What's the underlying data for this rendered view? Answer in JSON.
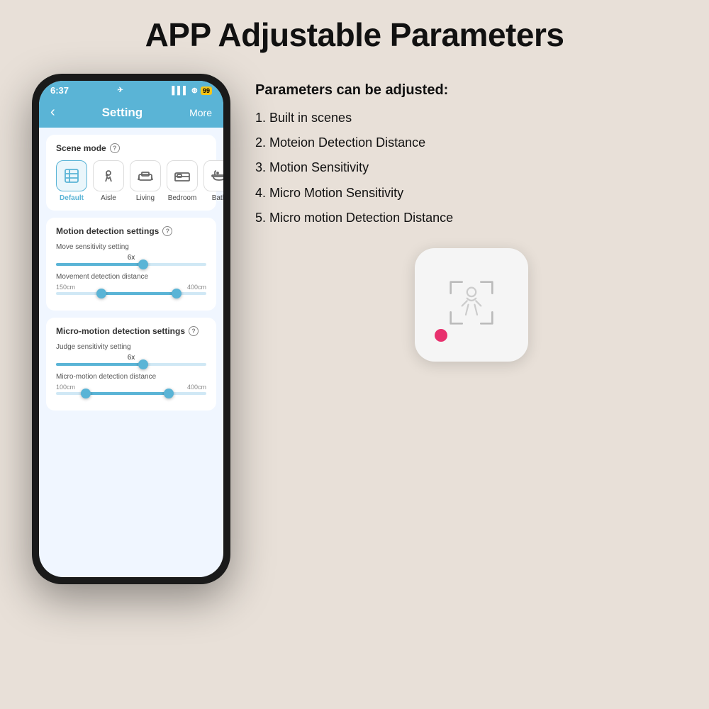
{
  "page": {
    "main_title": "APP Adjustable Parameters",
    "background_color": "#e8e0d8"
  },
  "phone": {
    "status_bar": {
      "time": "6:37",
      "location_icon": "▶",
      "signal": "▌▌▌",
      "wifi": "◆",
      "battery_label": "99"
    },
    "nav": {
      "back_label": "‹",
      "title": "Setting",
      "more_label": "More"
    },
    "scene_mode": {
      "title": "Scene mode",
      "help": "?",
      "scenes": [
        {
          "id": "default",
          "label": "Default",
          "icon": "☰",
          "active": true
        },
        {
          "id": "aisle",
          "label": "Aisle",
          "icon": "🔍",
          "active": false
        },
        {
          "id": "living",
          "label": "Living",
          "icon": "🛋",
          "active": false
        },
        {
          "id": "bedroom",
          "label": "Bedroom",
          "icon": "🛏",
          "active": false
        },
        {
          "id": "bath",
          "label": "Bath",
          "icon": "🚿",
          "active": false
        }
      ]
    },
    "motion_detection": {
      "title": "Motion detection settings",
      "help": "?",
      "move_sensitivity": {
        "label": "Move sensitivity setting",
        "value": "6x",
        "fill_pct": 58
      },
      "movement_distance": {
        "label": "Movement detection distance",
        "min": "150cm",
        "max": "400cm",
        "thumb1_pct": 30,
        "thumb2_pct": 80,
        "fill_start": 30,
        "fill_end": 80
      }
    },
    "micro_motion": {
      "title": "Micro-motion detection settings",
      "help": "?",
      "judge_sensitivity": {
        "label": "Judge sensitivity setting",
        "value": "6x",
        "fill_pct": 58
      },
      "micro_distance": {
        "label": "Micro-motion detection distance",
        "min": "100cm",
        "max": "400cm",
        "thumb1_pct": 20,
        "thumb2_pct": 75,
        "fill_start": 20,
        "fill_end": 75
      }
    }
  },
  "right_panel": {
    "intro": "Parameters can be adjusted:",
    "params": [
      "1. Built in scenes",
      "2. Moteion Detection Distance",
      "3. Motion Sensitivity",
      "4. Micro Motion Sensitivity",
      "5. Micro motion Detection Distance"
    ]
  },
  "device": {
    "aria": "motion sensor device",
    "dot_color": "#e8316e"
  }
}
